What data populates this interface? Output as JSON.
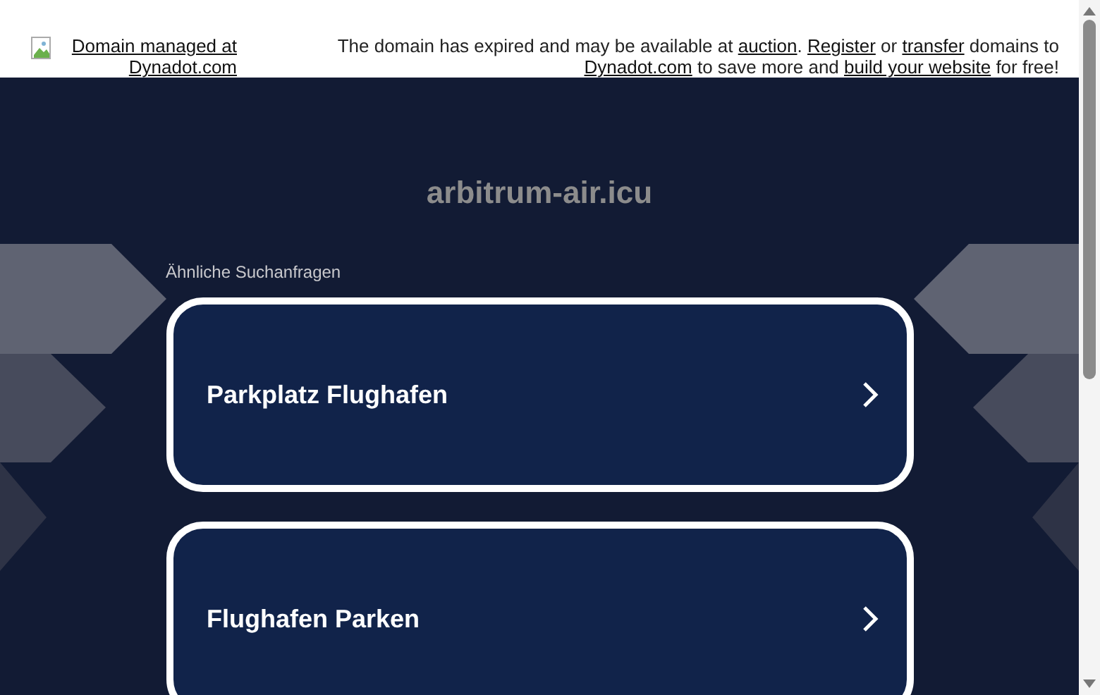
{
  "header": {
    "managed_link": "Domain managed at Dynadot.com",
    "notice": [
      {
        "kind": "text",
        "text": "The domain has expired and may be available at "
      },
      {
        "kind": "link",
        "text": "auction"
      },
      {
        "kind": "text",
        "text": ". "
      },
      {
        "kind": "link",
        "text": "Register"
      },
      {
        "kind": "text",
        "text": " or "
      },
      {
        "kind": "link",
        "text": "transfer"
      },
      {
        "kind": "text",
        "text": " domains to "
      },
      {
        "kind": "link",
        "text": "Dynadot.com"
      },
      {
        "kind": "text",
        "text": " to save more and "
      },
      {
        "kind": "link",
        "text": "build your website"
      },
      {
        "kind": "text",
        "text": " for free!"
      }
    ]
  },
  "domain_title": "arbitrum-air.icu",
  "related_label": "Ähnliche Suchanfragen",
  "search_links": [
    {
      "label": "Parkplatz Flughafen"
    },
    {
      "label": "Flughafen Parken"
    }
  ]
}
